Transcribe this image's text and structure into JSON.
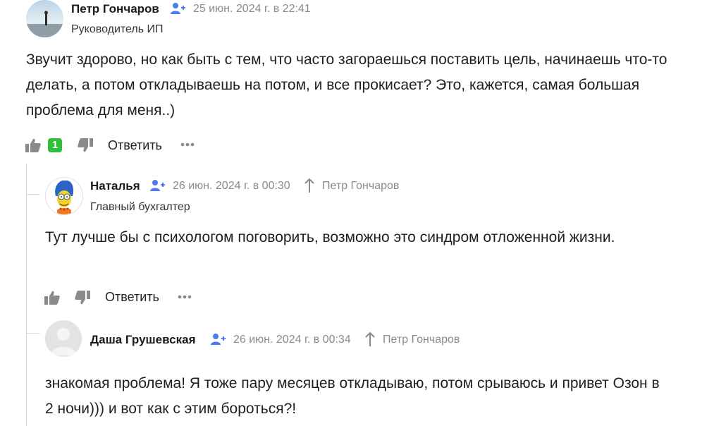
{
  "comments": [
    {
      "author": "Петр Гончаров",
      "date": "25 июн. 2024 г. в 22:41",
      "role": "Руководитель  ИП",
      "text": "Звучит здорово, но как быть с тем, что часто загораешься поставить цель, начинаешь что-то делать, а потом откладываешь на потом, и все прокисает? Это, кажется, самая большая проблема для меня..)",
      "likes": "1",
      "reply_label": "Ответить",
      "avatar_icon": "avatar-photo"
    },
    {
      "author": "Наталья",
      "date": "26 июн. 2024 г. в 00:30",
      "reply_to": "Петр Гончаров",
      "role": "Главный бухгалтер",
      "text": "Тут лучше бы с психологом поговорить, возможно это синдром отложенной жизни.",
      "reply_label": "Ответить",
      "avatar_icon": "avatar-cartoon"
    },
    {
      "author": "Даша Грушевская",
      "date": "26 июн. 2024 г. в 00:34",
      "reply_to": "Петр Гончаров",
      "text": "знакомая проблема! Я тоже пару месяцев откладываю, потом срываюсь и привет Озон в 2 ночи))) и вот как с этим бороться?!",
      "avatar_icon": "avatar-placeholder"
    }
  ],
  "colors": {
    "accent_blue": "#4a7cf0",
    "like_badge": "#2fbf3a",
    "muted_text": "#8a8a8a",
    "icon_gray": "#8a8a8a"
  }
}
